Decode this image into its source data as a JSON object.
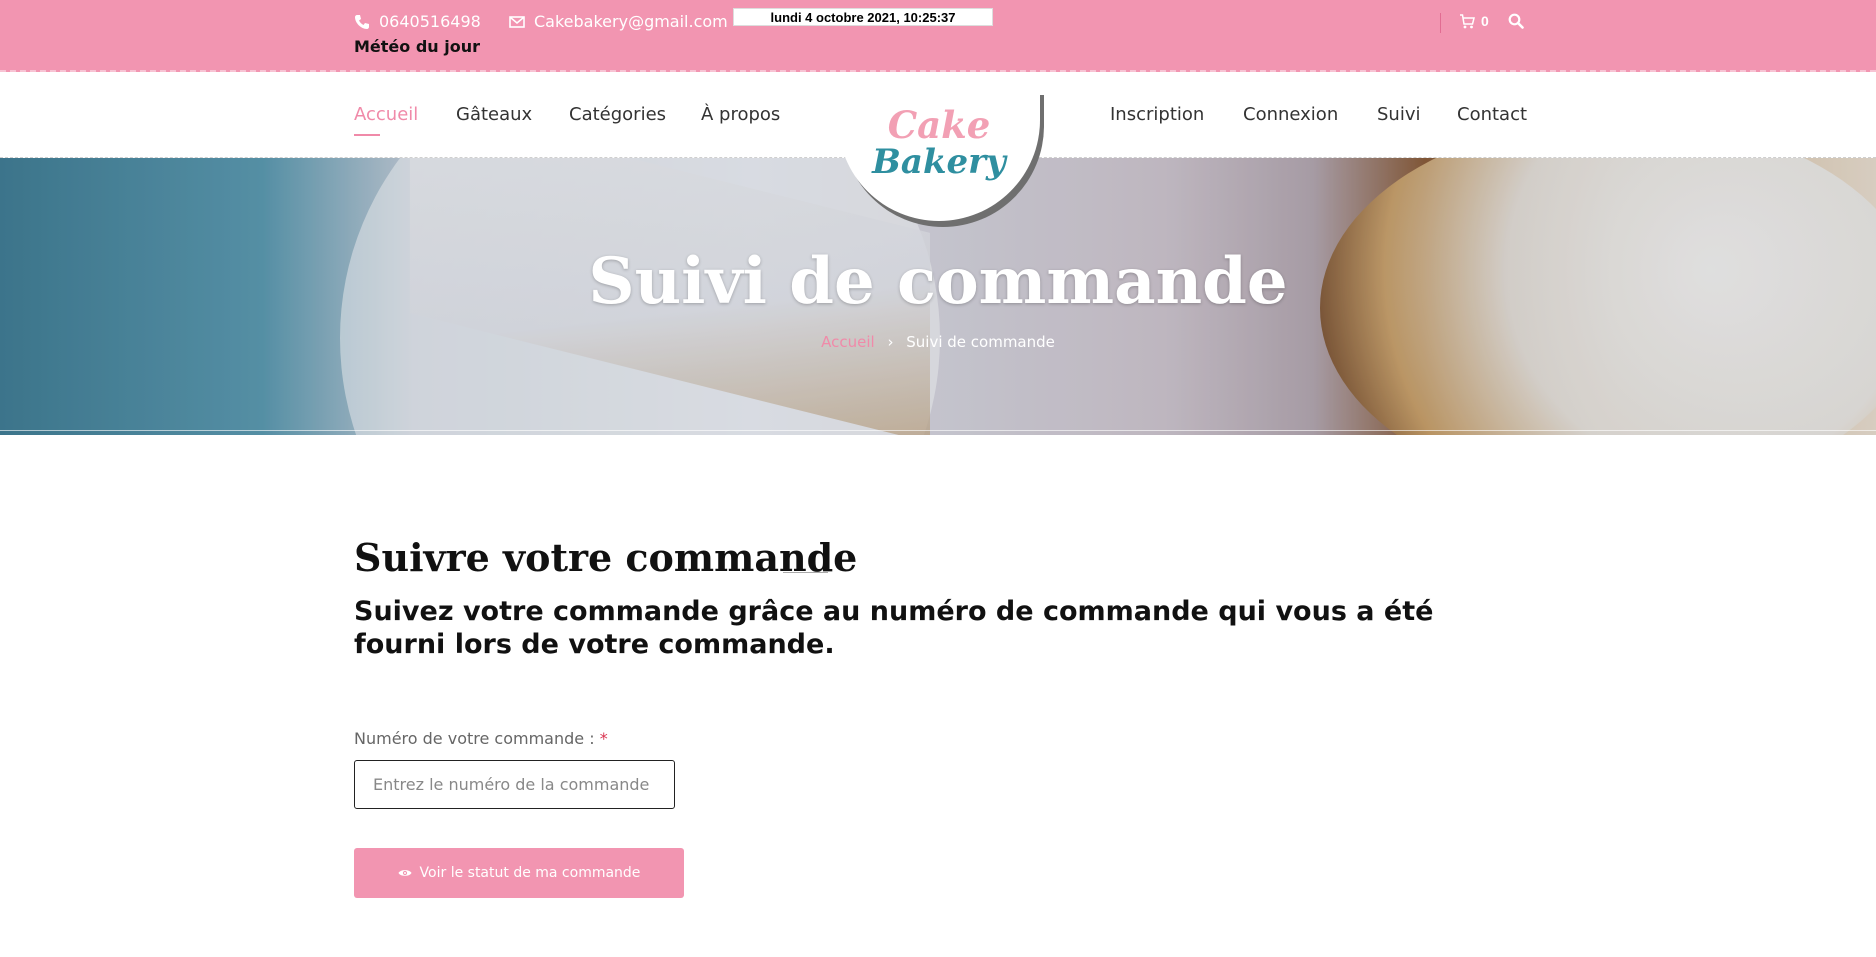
{
  "topbar": {
    "phone": "0640516498",
    "email": "Cakebakery@gmail.com",
    "datetime": "lundi 4 octobre 2021, 10:25:37",
    "weather_label": "Météo du jour",
    "cart_count": "0",
    "icons": {
      "phone": "phone-icon",
      "email": "envelope-icon",
      "cart": "cart-icon",
      "search": "search-icon"
    }
  },
  "nav": {
    "left": [
      {
        "label": "Accueil",
        "active": true
      },
      {
        "label": "Gâteaux"
      },
      {
        "label": "Catégories"
      },
      {
        "label": "À propos"
      }
    ],
    "right": [
      {
        "label": "Inscription"
      },
      {
        "label": "Connexion"
      },
      {
        "label": "Suivi"
      },
      {
        "label": "Contact"
      }
    ]
  },
  "logo": {
    "line1": "Cake",
    "line2": "Bakery"
  },
  "hero": {
    "title": "Suivi de commande",
    "breadcrumb": {
      "home": "Accueil",
      "current": "Suivi de commande"
    }
  },
  "main": {
    "title": "Suivre votre commande",
    "subtitle": "Suivez votre commande grâce au numéro de commande qui vous a été fourni lors de votre commande.",
    "field_label": "Numéro de votre commande :",
    "required_mark": "*",
    "input_placeholder": "Entrez le numéro de la commande ici",
    "input_value": "",
    "button_label": "Voir le statut de ma commande"
  },
  "colors": {
    "accent": "#f295b1",
    "nav_active": "#f08aa9",
    "logo_teal": "#2f8fa0"
  }
}
